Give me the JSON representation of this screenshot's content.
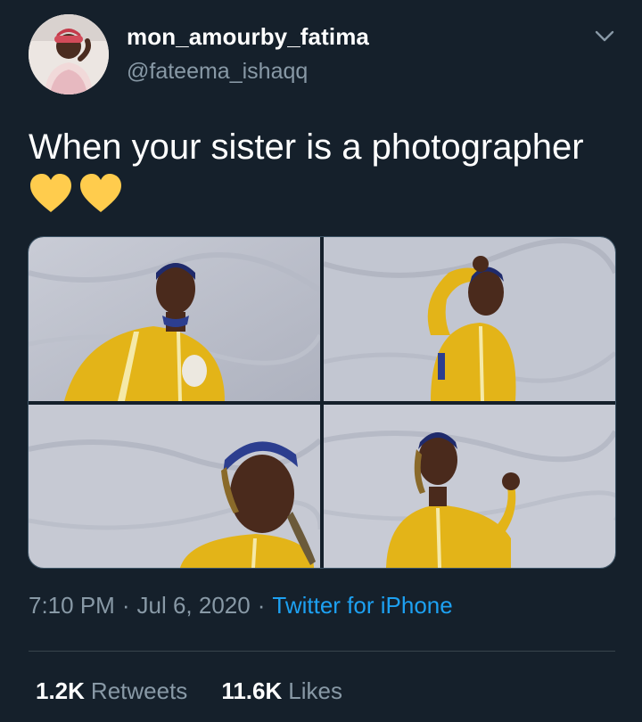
{
  "author": {
    "display_name": "mon_amourby_fatima",
    "handle": "@fateema_ishaqq"
  },
  "tweet": {
    "text": "When your sister is a photographer",
    "emoji": [
      "yellow-heart-icon",
      "yellow-heart-icon"
    ],
    "media": [
      "photo-1",
      "photo-2",
      "photo-3",
      "photo-4"
    ]
  },
  "meta": {
    "time": "7:10 PM",
    "separator": "·",
    "date": "Jul 6, 2020",
    "source": "Twitter for iPhone"
  },
  "stats": {
    "retweets_count": "1.2K",
    "retweets_label": "Retweets",
    "likes_count": "11.6K",
    "likes_label": "Likes"
  },
  "colors": {
    "background": "#15202b",
    "primary_text": "#ffffff",
    "secondary_text": "#8899a6",
    "link": "#1da1f2",
    "heart": "#ffcc4d",
    "outfit": "#e8b417"
  }
}
